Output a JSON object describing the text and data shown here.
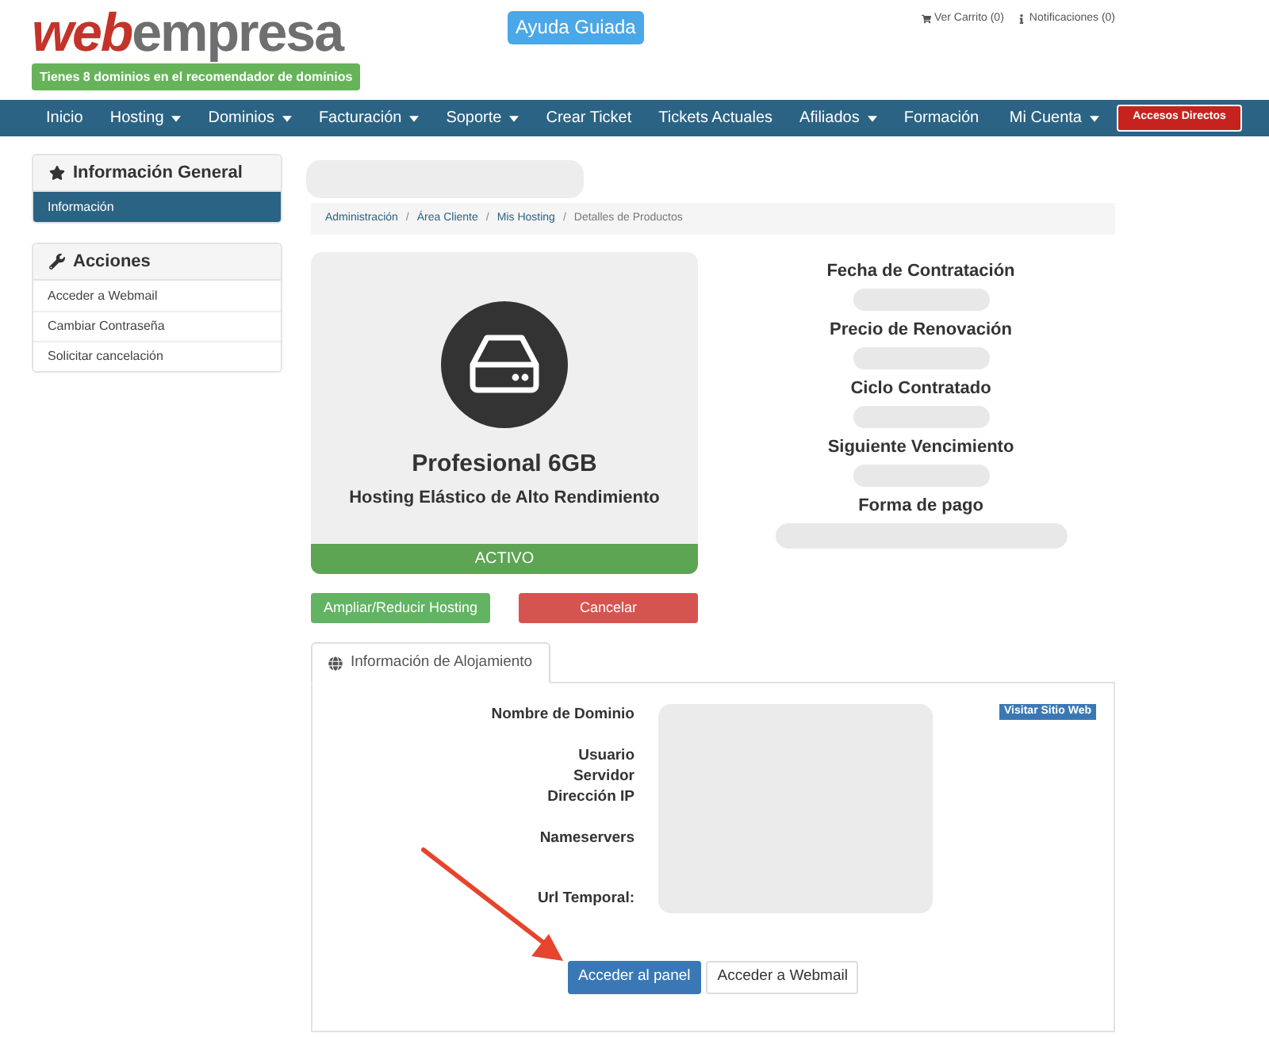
{
  "header": {
    "logo": [
      "web",
      "empresa"
    ],
    "promo_badge": "Tienes 8 dominios en el recomendador de dominios",
    "help_button": "Ayuda Guiada",
    "top_links": [
      {
        "kind": "cart",
        "label": "Ver Carrito (0)"
      },
      {
        "kind": "info",
        "label": "Notificaciones (0)"
      }
    ]
  },
  "nav": {
    "items": [
      {
        "label": "Inicio",
        "dropdown": false
      },
      {
        "label": "Hosting",
        "dropdown": true
      },
      {
        "label": "Dominios",
        "dropdown": true
      },
      {
        "label": "Facturación",
        "dropdown": true
      },
      {
        "label": "Soporte",
        "dropdown": true
      },
      {
        "label": "Crear Ticket",
        "dropdown": false
      },
      {
        "label": "Tickets Actuales",
        "dropdown": false
      },
      {
        "label": "Afiliados",
        "dropdown": true
      },
      {
        "label": "Formación",
        "dropdown": false
      }
    ],
    "account": {
      "label": "Mi Cuenta",
      "dropdown": true
    },
    "shortcut_button": "Accesos Directos"
  },
  "sidebar": {
    "panels": [
      {
        "title": "Información General",
        "items": [
          {
            "label": "Información",
            "selected": true
          }
        ]
      },
      {
        "title": "Acciones",
        "items": [
          {
            "label": "Acceder a Webmail",
            "selected": false
          },
          {
            "label": "Cambiar Contraseña",
            "selected": false
          },
          {
            "label": "Solicitar cancelación",
            "selected": false
          }
        ]
      }
    ]
  },
  "breadcrumb": {
    "separator": "/",
    "items": [
      {
        "label": "Administración",
        "current": false
      },
      {
        "label": "Área Cliente",
        "current": false
      },
      {
        "label": "Mis Hosting",
        "current": false
      },
      {
        "label": "Detalles de Productos",
        "current": true
      }
    ]
  },
  "product": {
    "name": "Profesional 6GB",
    "description": "Hosting Elástico de Alto Rendimiento",
    "status": "ACTIVO"
  },
  "actions": [
    {
      "kind": "success",
      "label": "Ampliar/Reducir Hosting"
    },
    {
      "kind": "danger",
      "label": "Cancelar"
    }
  ],
  "details": [
    "Fecha de Contratación",
    "Precio de Renovación",
    "Ciclo Contratado",
    "Siguiente Vencimiento",
    "Forma de pago"
  ],
  "tabs": [
    {
      "label": "Información de Alojamiento",
      "selected": true
    }
  ],
  "hosting_info": {
    "label_groups": [
      [
        "Nombre de Dominio"
      ],
      [
        "Usuario",
        "Servidor",
        "Dirección IP"
      ],
      [
        "Nameservers"
      ],
      [
        "Url Temporal:"
      ]
    ],
    "visit_button": "Visitar Sitio Web",
    "buttons": [
      {
        "kind": "primary",
        "label": "Acceder al panel"
      },
      {
        "kind": "default",
        "label": "Acceder a Webmail"
      }
    ]
  }
}
